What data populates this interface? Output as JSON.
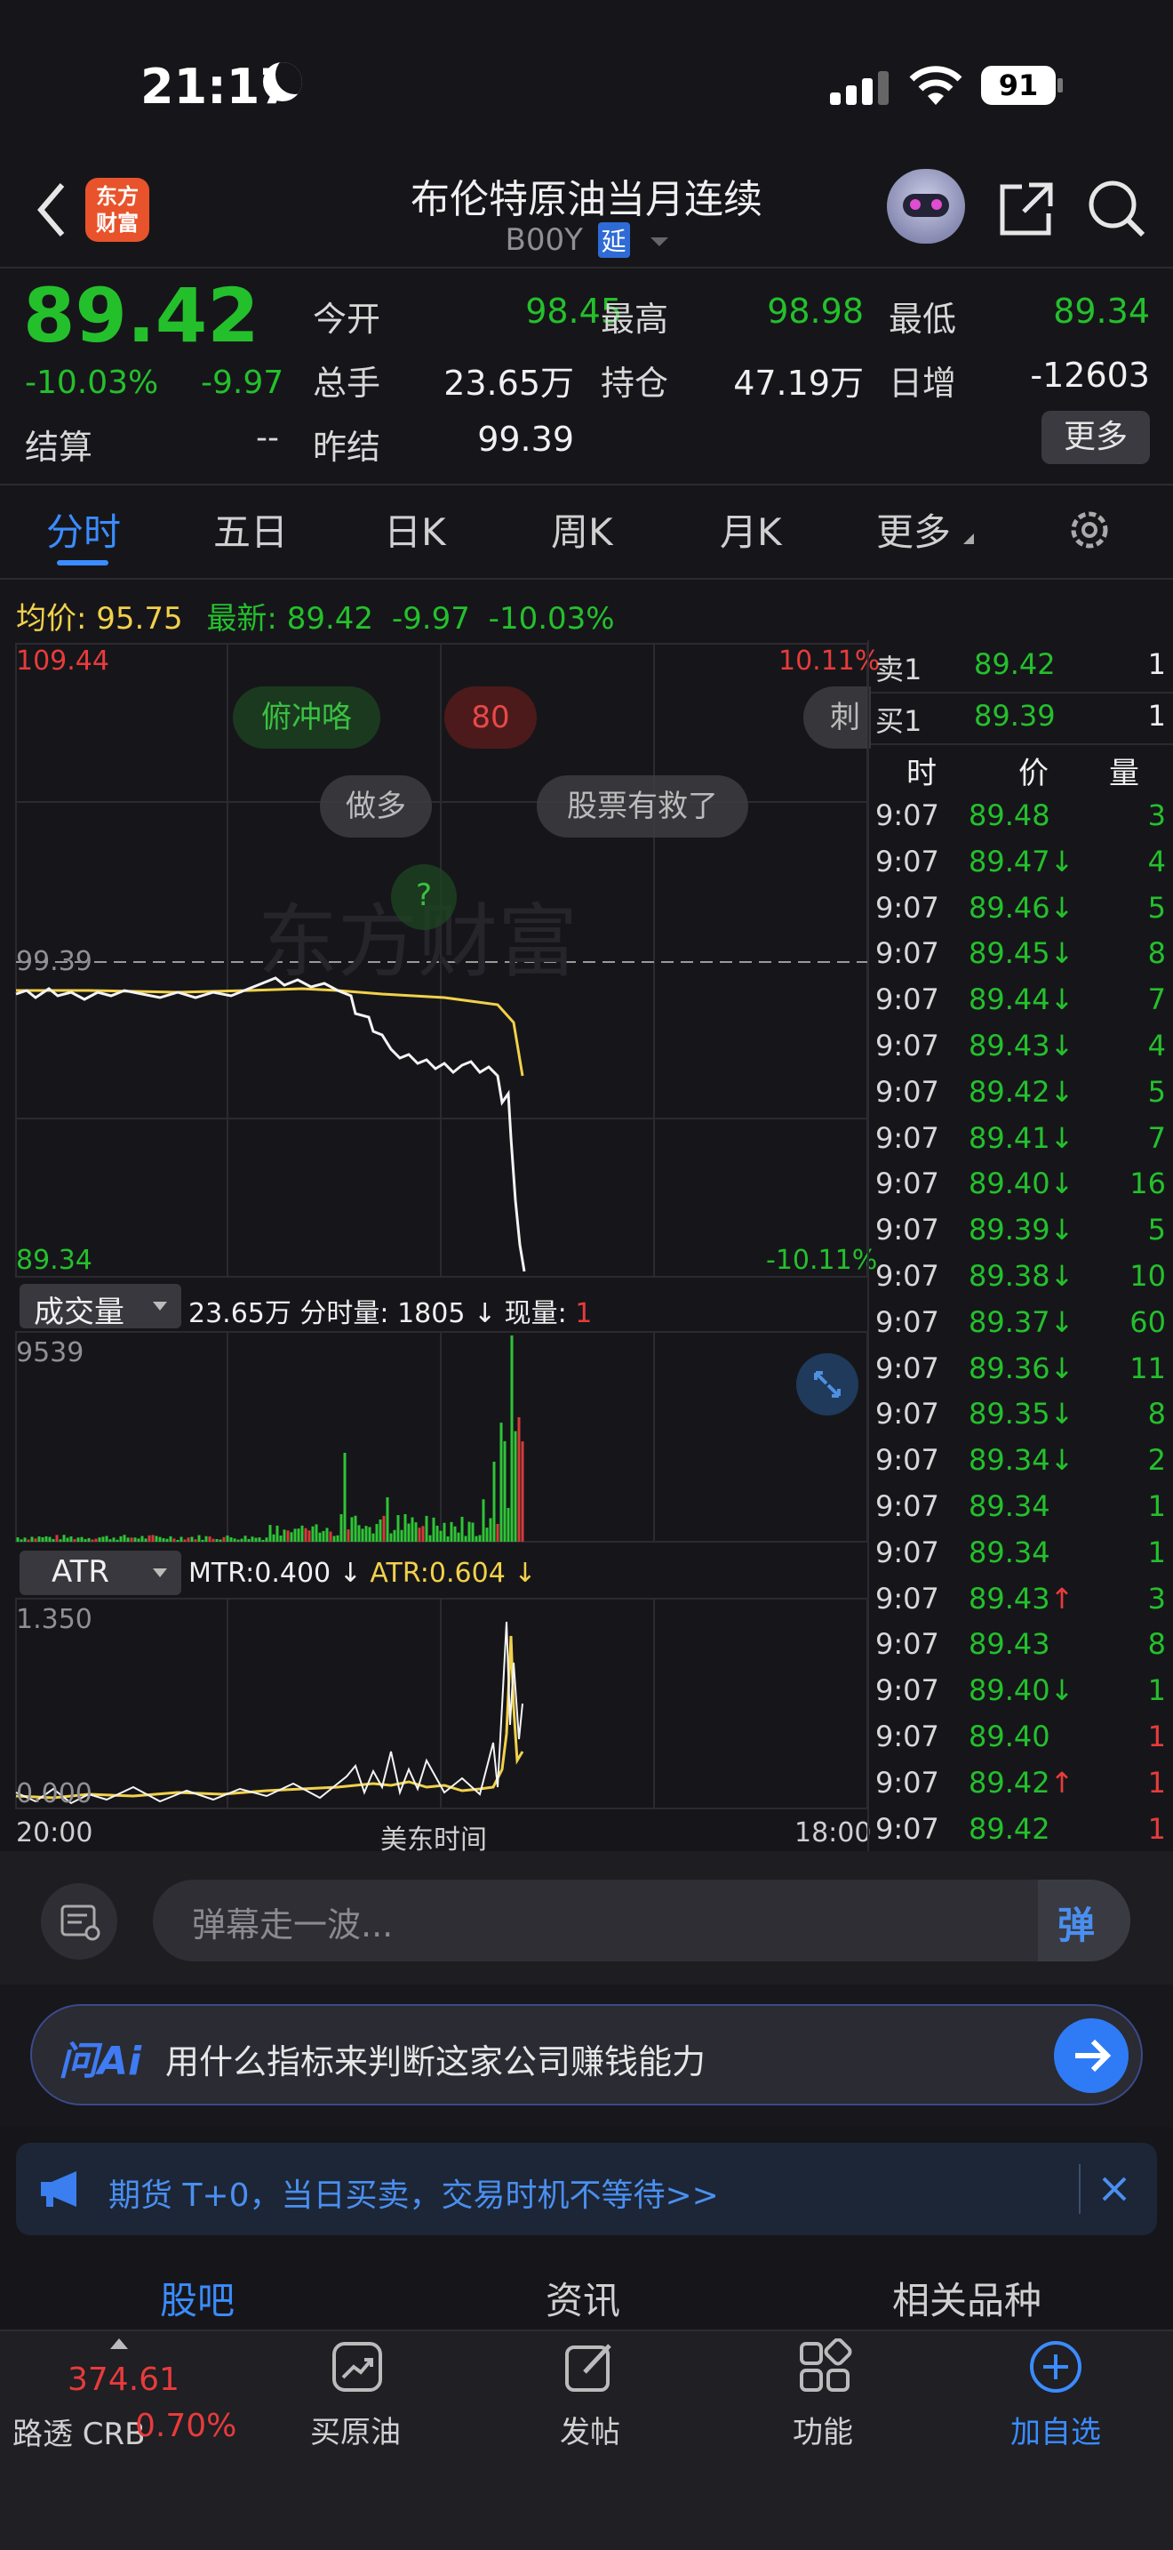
{
  "status_bar": {
    "time": "21:17",
    "battery": "91"
  },
  "header": {
    "logo_line1": "东方",
    "logo_line2": "财富",
    "title": "布伦特原油当月连续",
    "code": "B00Y",
    "delay_badge": "延"
  },
  "quote": {
    "price": "89.42",
    "change_pct": "-10.03%",
    "change": "-9.97",
    "settle_label": "结算",
    "settle_value": "--",
    "fields": [
      {
        "label": "今开",
        "value": "98.45",
        "color": "#24c02c"
      },
      {
        "label": "最高",
        "value": "98.98",
        "color": "#24c02c"
      },
      {
        "label": "最低",
        "value": "89.34",
        "color": "#24c02c"
      },
      {
        "label": "总手",
        "value": "23.65万",
        "color": "#f0f0f0"
      },
      {
        "label": "持仓",
        "value": "47.19万",
        "color": "#f0f0f0"
      },
      {
        "label": "日增",
        "value": "-12603",
        "color": "#f0f0f0"
      },
      {
        "label": "昨结",
        "value": "99.39",
        "color": "#f0f0f0"
      }
    ],
    "more_button": "更多"
  },
  "tabs": [
    "分时",
    "五日",
    "日K",
    "周K",
    "月K",
    "更多"
  ],
  "info_line": {
    "avg_label": "均价:",
    "avg_value": "95.75",
    "latest_label": "最新:",
    "latest_value": "89.42",
    "change": "-9.97",
    "change_pct": "-10.03%"
  },
  "chart_main": {
    "y_top": "109.44",
    "y_top_pct": "10.11%",
    "ref": "99.39",
    "y_bottom": "89.34",
    "y_bottom_pct": "-10.11%",
    "bubbles": [
      "俯冲咯",
      "80",
      "刺",
      "做多",
      "股票有救了",
      "?"
    ]
  },
  "volume_panel": {
    "selector": "成交量",
    "summary": "23.65万 分时量: 1805 ↓ 现量:",
    "now_qty": "1",
    "max": "9539"
  },
  "atr_panel": {
    "selector": "ATR",
    "mtr": "MTR:0.400 ↓",
    "atr": "ATR:0.604 ↓",
    "max": "1.350",
    "min": "0.000"
  },
  "x_axis": {
    "left": "20:00",
    "mid": "美东时间",
    "right": "18:00"
  },
  "order_book": {
    "ask_label": "卖1",
    "ask_price": "89.42",
    "ask_qty": "1",
    "bid_label": "买1",
    "bid_price": "89.39",
    "bid_qty": "1",
    "col_time": "时",
    "col_price": "价",
    "col_qty": "量",
    "ticks": [
      {
        "t": "9:07",
        "p": "89.48",
        "a": "",
        "q": "3"
      },
      {
        "t": "9:07",
        "p": "89.47",
        "a": "↓",
        "q": "4"
      },
      {
        "t": "9:07",
        "p": "89.46",
        "a": "↓",
        "q": "5"
      },
      {
        "t": "9:07",
        "p": "89.45",
        "a": "↓",
        "q": "8"
      },
      {
        "t": "9:07",
        "p": "89.44",
        "a": "↓",
        "q": "7"
      },
      {
        "t": "9:07",
        "p": "89.43",
        "a": "↓",
        "q": "4"
      },
      {
        "t": "9:07",
        "p": "89.42",
        "a": "↓",
        "q": "5"
      },
      {
        "t": "9:07",
        "p": "89.41",
        "a": "↓",
        "q": "7"
      },
      {
        "t": "9:07",
        "p": "89.40",
        "a": "↓",
        "q": "16"
      },
      {
        "t": "9:07",
        "p": "89.39",
        "a": "↓",
        "q": "5"
      },
      {
        "t": "9:07",
        "p": "89.38",
        "a": "↓",
        "q": "10"
      },
      {
        "t": "9:07",
        "p": "89.37",
        "a": "↓",
        "q": "60"
      },
      {
        "t": "9:07",
        "p": "89.36",
        "a": "↓",
        "q": "11"
      },
      {
        "t": "9:07",
        "p": "89.35",
        "a": "↓",
        "q": "8"
      },
      {
        "t": "9:07",
        "p": "89.34",
        "a": "↓",
        "q": "2"
      },
      {
        "t": "9:07",
        "p": "89.34",
        "a": "",
        "q": "1"
      },
      {
        "t": "9:07",
        "p": "89.34",
        "a": "",
        "q": "1"
      },
      {
        "t": "9:07",
        "p": "89.43",
        "a": "↑",
        "q": "3"
      },
      {
        "t": "9:07",
        "p": "89.43",
        "a": "",
        "q": "8"
      },
      {
        "t": "9:07",
        "p": "89.40",
        "a": "↓",
        "q": "1"
      },
      {
        "t": "9:07",
        "p": "89.40",
        "a": "",
        "q": "1"
      },
      {
        "t": "9:07",
        "p": "89.42",
        "a": "↑",
        "q": "1"
      },
      {
        "t": "9:07",
        "p": "89.42",
        "a": "",
        "q": "1"
      }
    ]
  },
  "danmaku": {
    "placeholder": "弹幕走一波...",
    "send": "弹"
  },
  "ai_bar": {
    "brand": "问Ai",
    "prompt": "用什么指标来判断这家公司赚钱能力"
  },
  "banner": {
    "text": "期货 T+0，当日买卖，交易时机不等待>>"
  },
  "sub_tabs": [
    "股吧",
    "资讯",
    "相关品种"
  ],
  "bottom_nav": {
    "index_value": "374.61",
    "index_name": "路透 CRB",
    "index_pct": "0.70%",
    "items": [
      "买原油",
      "发帖",
      "功能",
      "加自选"
    ]
  }
}
